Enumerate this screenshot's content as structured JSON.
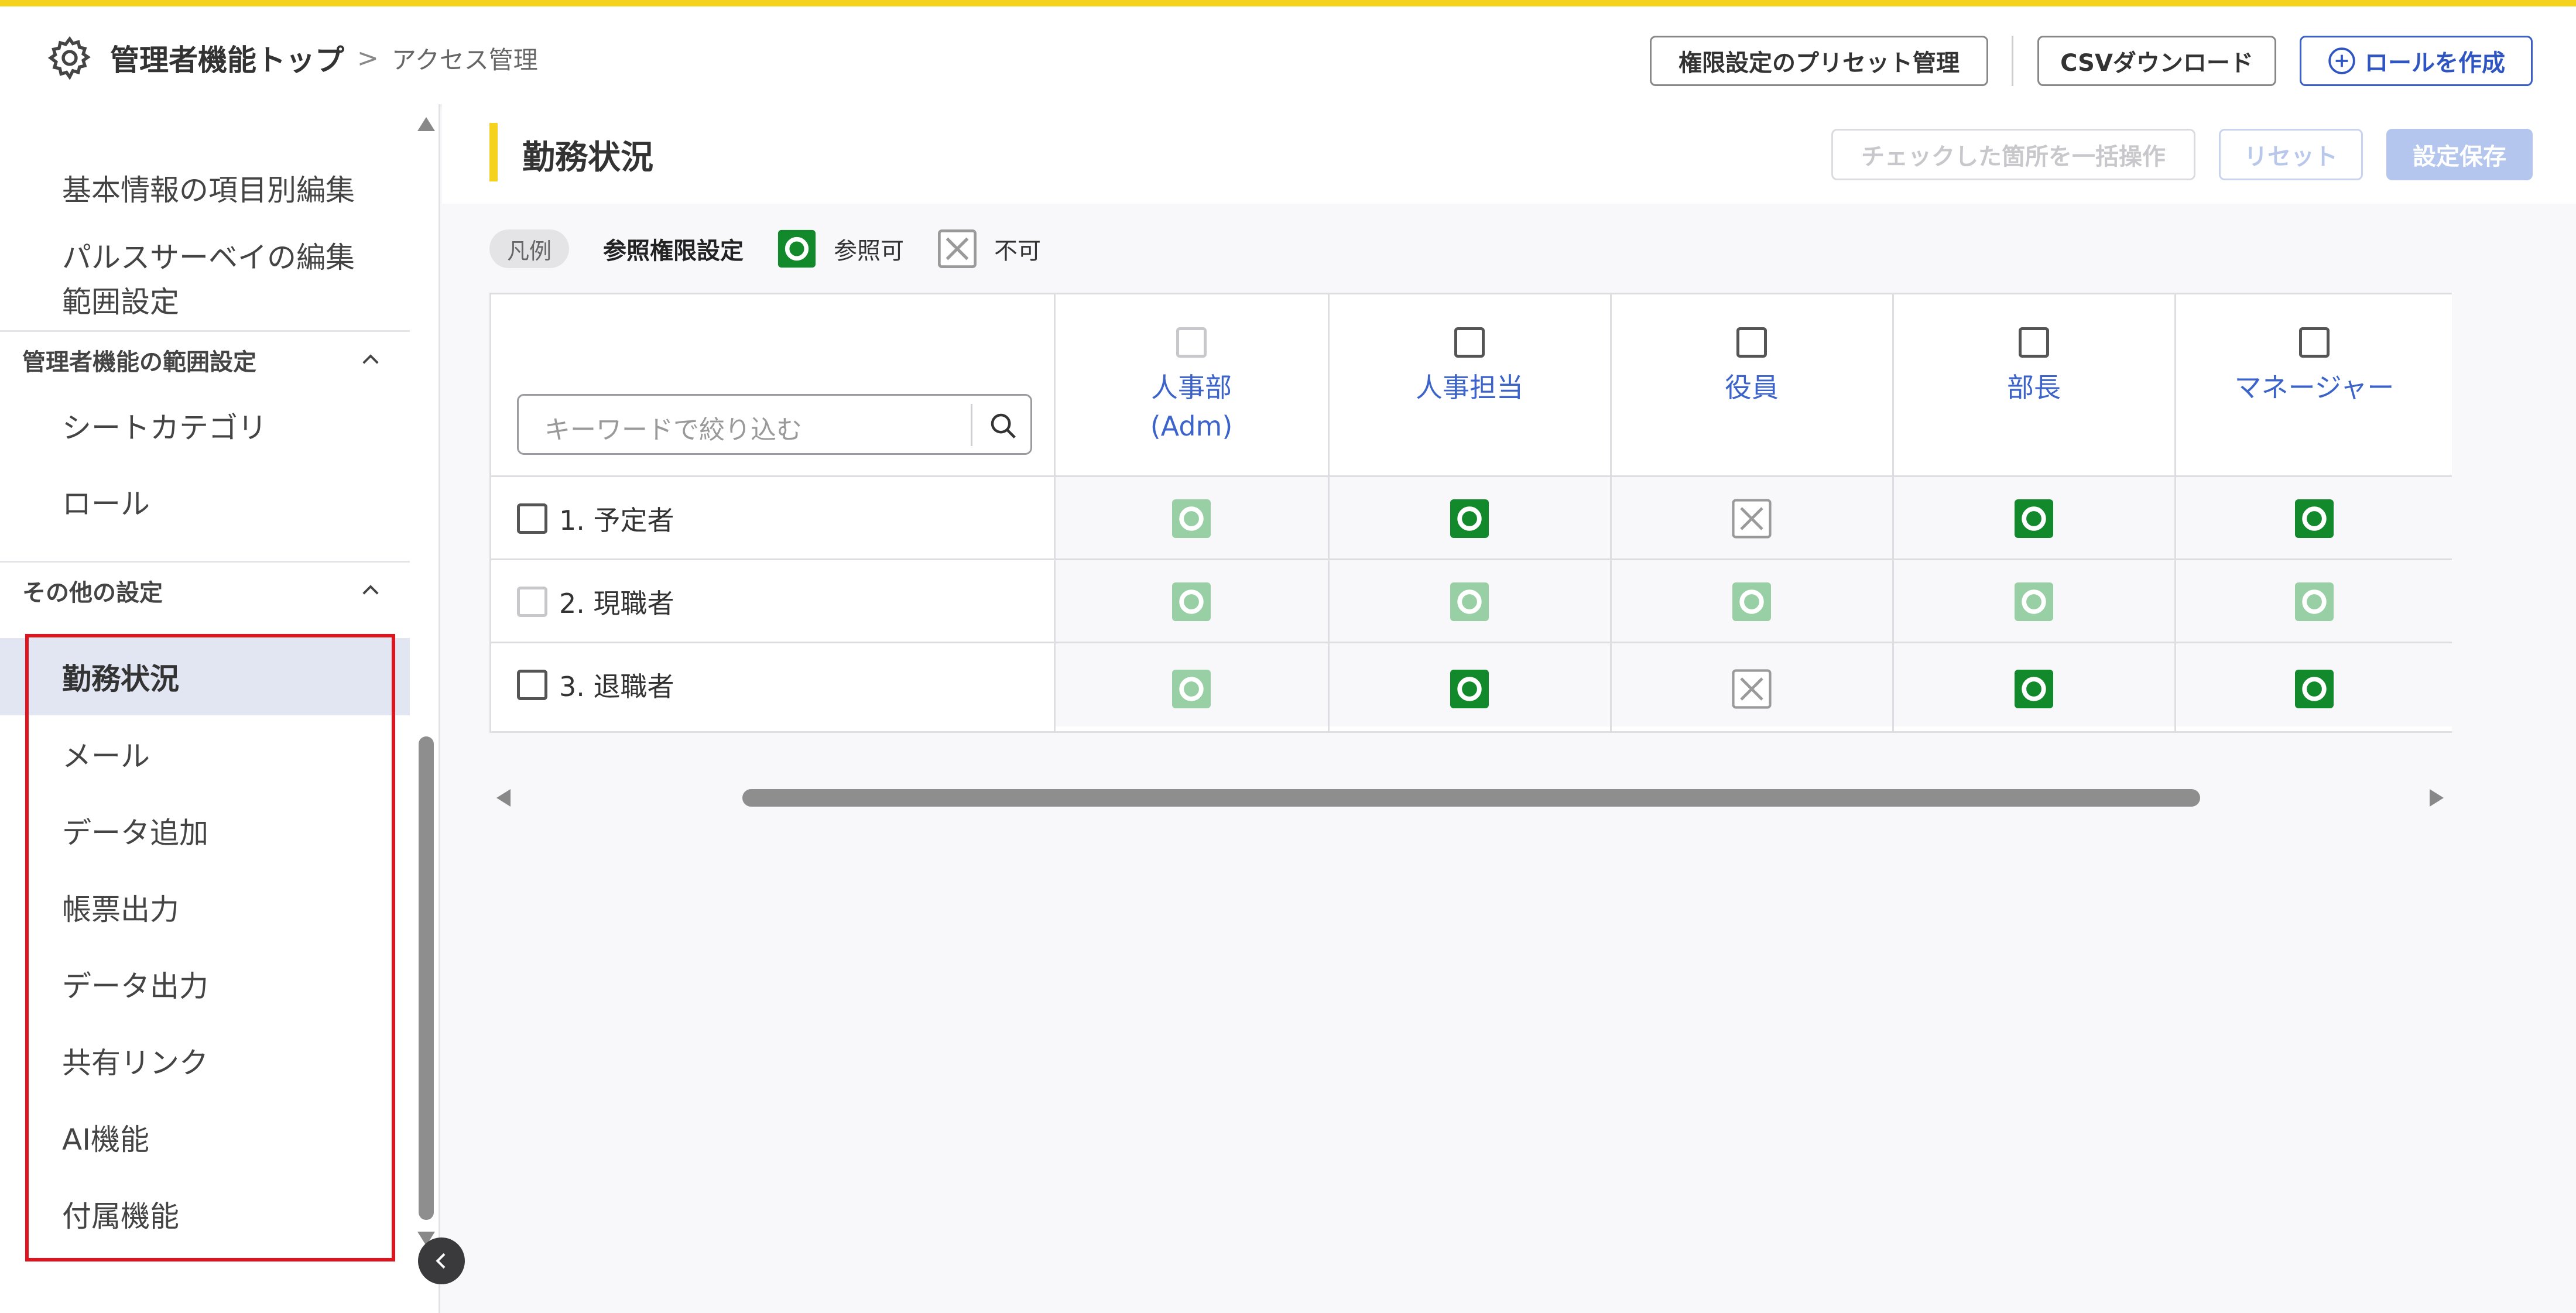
{
  "header": {
    "home_label": "管理者機能トップ",
    "separator": ">",
    "current_label": "アクセス管理",
    "preset_button": "権限設定のプリセット管理",
    "csv_button": "CSVダウンロード",
    "create_role_button": "ロールを作成",
    "accent_color": "#f5d21e"
  },
  "sidebar": {
    "items_top": [
      {
        "label": "基本情報の項目別編集"
      },
      {
        "label": "パルスサーベイの編集範囲設定"
      }
    ],
    "sections": [
      {
        "title": "管理者機能の範囲設定",
        "expanded": true,
        "items": [
          {
            "label": "シートカテゴリ"
          },
          {
            "label": "ロール"
          }
        ]
      },
      {
        "title": "その他の設定",
        "expanded": true,
        "items": [
          {
            "label": "勤務状況",
            "active": true
          },
          {
            "label": "メール"
          },
          {
            "label": "データ追加"
          },
          {
            "label": "帳票出力"
          },
          {
            "label": "データ出力"
          },
          {
            "label": "共有リンク"
          },
          {
            "label": "AI機能"
          },
          {
            "label": "付属機能"
          }
        ]
      }
    ],
    "highlight_color": "#e0141e"
  },
  "main": {
    "title": "勤務状況",
    "bulk_button": "チェックした箇所を一括操作",
    "reset_button": "リセット",
    "save_button": "設定保存",
    "legend": {
      "tag": "凡例",
      "label": "参照権限設定",
      "allow": "参照可",
      "deny": "不可"
    },
    "search_placeholder": "キーワードで絞り込む",
    "columns": [
      {
        "name": "人事部\n(Adm)",
        "checkbox": "disabled"
      },
      {
        "name": "人事担当",
        "checkbox": "enabled"
      },
      {
        "name": "役員",
        "checkbox": "enabled"
      },
      {
        "name": "部長",
        "checkbox": "enabled"
      },
      {
        "name": "マネージャー",
        "checkbox": "enabled"
      }
    ],
    "rows": [
      {
        "label": "1. 予定者",
        "checkbox": "enabled",
        "cells": [
          "allow-disabled",
          "allow",
          "deny",
          "allow",
          "allow"
        ]
      },
      {
        "label": "2. 現職者",
        "checkbox": "disabled",
        "cells": [
          "allow-disabled",
          "allow-disabled",
          "allow-disabled",
          "allow-disabled",
          "allow-disabled"
        ]
      },
      {
        "label": "3. 退職者",
        "checkbox": "enabled",
        "cells": [
          "allow-disabled",
          "allow",
          "deny",
          "allow",
          "allow"
        ]
      }
    ],
    "colors": {
      "allow": "#128a2c",
      "allow_disabled": "#98cfa4",
      "deny": "#9a9a9a",
      "link": "#3b63c9",
      "save_button": "#b4c6ee"
    }
  }
}
